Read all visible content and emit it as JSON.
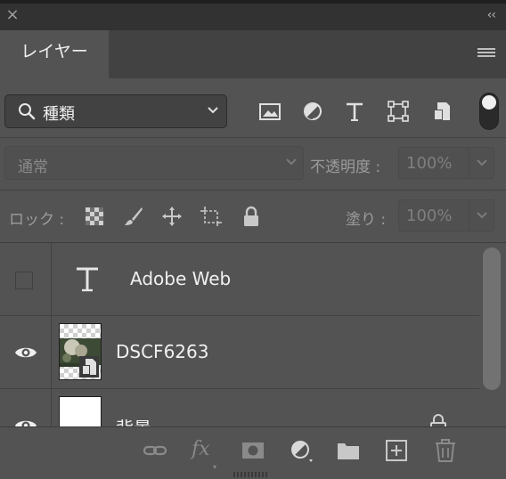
{
  "panel": {
    "tab_label": "レイヤー",
    "collapse_glyph": "‹‹",
    "close_glyph": "×"
  },
  "filter": {
    "kind_value": "種類",
    "icons": [
      "image-filter-icon",
      "adjustment-filter-icon",
      "type-filter-icon",
      "shape-filter-icon",
      "smart-object-filter-icon"
    ],
    "toggle_on": true
  },
  "blend": {
    "mode_value": "通常",
    "opacity_label": "不透明度 :",
    "opacity_value": "100%"
  },
  "lock": {
    "label": "ロック :",
    "fill_label": "塗り :",
    "fill_value": "100%"
  },
  "layers": [
    {
      "name": "Adobe Web",
      "kind": "type",
      "visible": false
    },
    {
      "name": "DSCF6263",
      "kind": "smart-object",
      "visible": true
    },
    {
      "name": "背景",
      "kind": "background",
      "visible": true,
      "locked": true
    }
  ],
  "toolbar": {
    "fx_label": "fx",
    "icons": [
      "link-layers-icon",
      "layer-style-icon",
      "add-mask-icon",
      "new-adjustment-layer-icon",
      "new-group-icon",
      "new-layer-icon",
      "delete-layer-icon"
    ]
  },
  "colors": {
    "panel_bg": "#535353",
    "dark_bg": "#323232",
    "text": "#f0f0f0",
    "dim_text": "#9c9c9c"
  }
}
